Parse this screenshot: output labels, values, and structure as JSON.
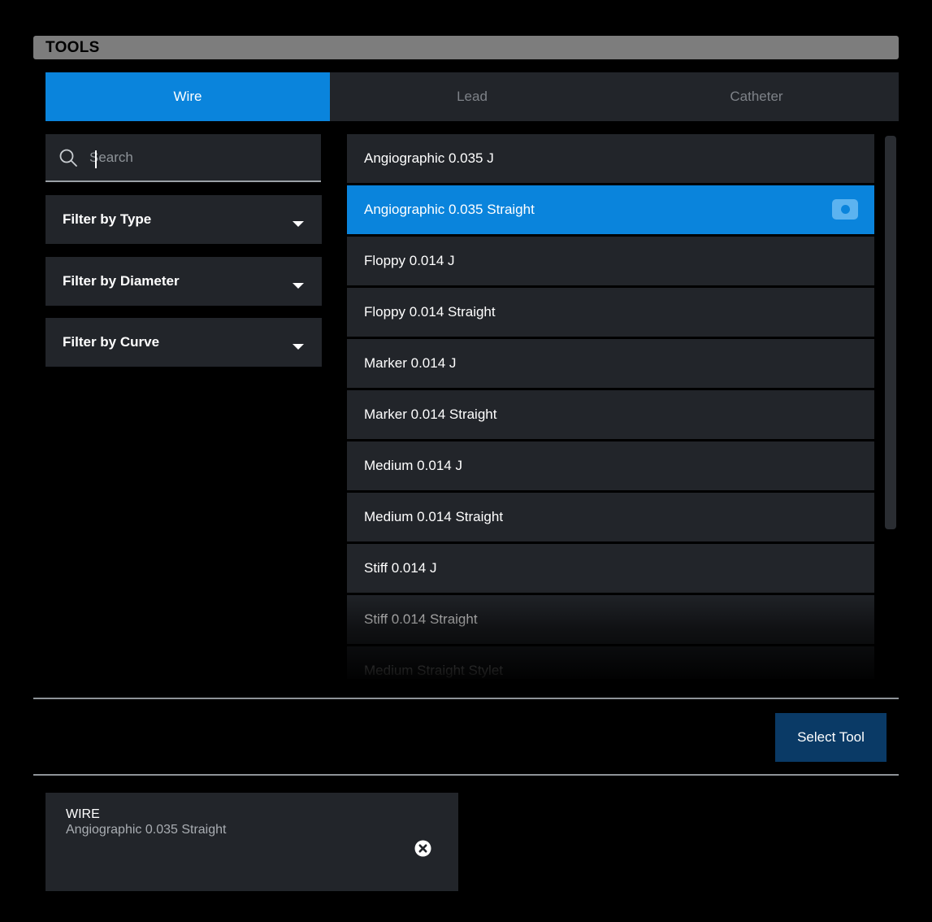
{
  "window": {
    "title": "TOOLS"
  },
  "tabs": [
    {
      "label": "Wire",
      "active": true
    },
    {
      "label": "Lead",
      "active": false
    },
    {
      "label": "Catheter",
      "active": false
    }
  ],
  "search": {
    "placeholder": "Search",
    "value": ""
  },
  "filters": [
    {
      "label": "Filter by Type"
    },
    {
      "label": "Filter by Diameter"
    },
    {
      "label": "Filter by Curve"
    }
  ],
  "tool_list": {
    "items": [
      {
        "label": "Angiographic 0.035 J"
      },
      {
        "label": "Angiographic 0.035 Straight",
        "selected": true
      },
      {
        "label": "Floppy 0.014 J"
      },
      {
        "label": "Floppy 0.014 Straight"
      },
      {
        "label": "Marker 0.014 J"
      },
      {
        "label": "Marker 0.014 Straight"
      },
      {
        "label": "Medium 0.014 J"
      },
      {
        "label": "Medium 0.014 Straight"
      },
      {
        "label": "Stiff 0.014 J"
      },
      {
        "label": "Stiff 0.014 Straight"
      },
      {
        "label": "Medium Straight Stylet"
      }
    ]
  },
  "actions": {
    "select_tool_label": "Select Tool"
  },
  "selected_tool": {
    "category": "WIRE",
    "name": "Angiographic 0.035 Straight"
  },
  "colors": {
    "accent": "#0a84dc",
    "panel": "#22252a",
    "background": "#000000",
    "header_bar": "#7d7d7d",
    "select_button": "#0a3a66"
  }
}
